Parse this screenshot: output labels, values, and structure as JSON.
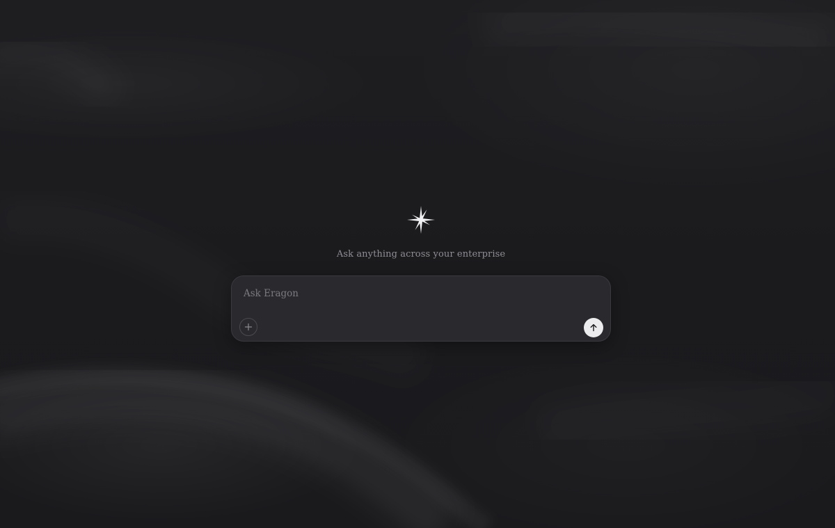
{
  "hero": {
    "logo_icon": "sparkle-star-icon",
    "tagline": "Ask anything across your enterprise"
  },
  "composer": {
    "placeholder": "Ask Eragon",
    "value": "",
    "add_icon": "plus-icon",
    "send_icon": "arrow-up-icon"
  },
  "colors": {
    "background": "#1c1c1f",
    "composer_bg": "#2a2a2e",
    "tagline_text": "#8e8e94",
    "send_button_bg": "#ececee"
  }
}
